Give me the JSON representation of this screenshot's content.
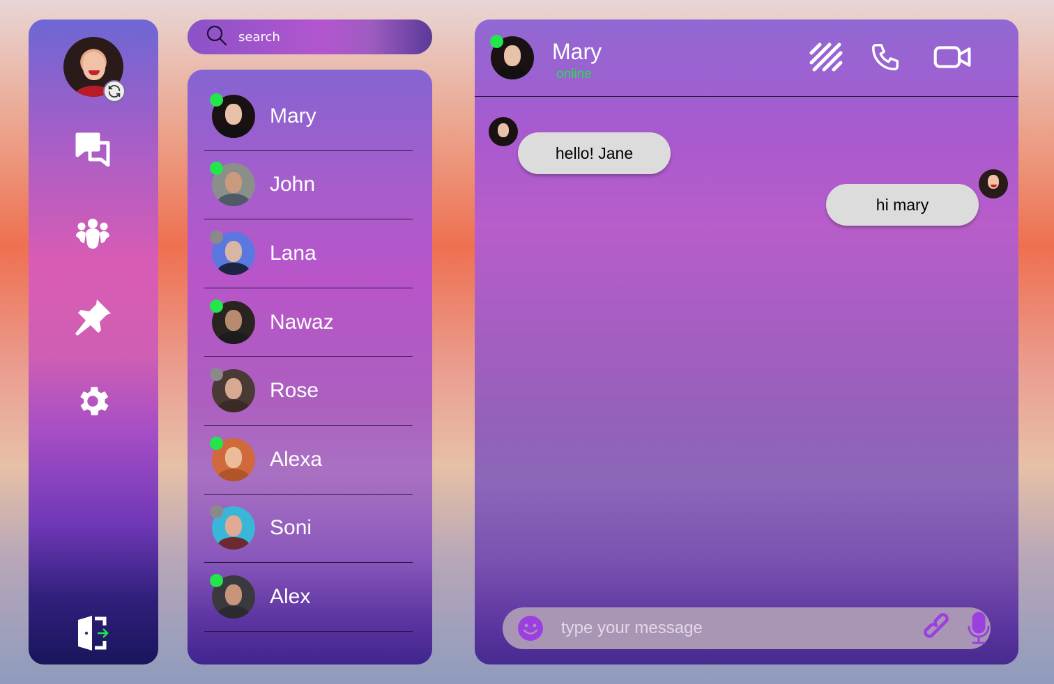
{
  "sidebar": {
    "profile_icon": "user-avatar",
    "sync_icon": "sync-icon",
    "nav": [
      {
        "id": "chats",
        "icon": "chat-bubbles-icon"
      },
      {
        "id": "groups",
        "icon": "group-icon"
      },
      {
        "id": "pinned",
        "icon": "pin-icon"
      },
      {
        "id": "settings",
        "icon": "gear-icon"
      }
    ],
    "logout_icon": "logout-icon"
  },
  "search": {
    "placeholder": "search"
  },
  "contacts": [
    {
      "name": "Mary",
      "online": true
    },
    {
      "name": "John",
      "online": true
    },
    {
      "name": "Lana",
      "online": false
    },
    {
      "name": "Nawaz",
      "online": true
    },
    {
      "name": "Rose",
      "online": false
    },
    {
      "name": "Alexa",
      "online": true
    },
    {
      "name": "Soni",
      "online": false
    },
    {
      "name": "Alex",
      "online": true
    }
  ],
  "chat": {
    "contact_name": "Mary",
    "contact_status": "online",
    "messages": [
      {
        "from": "them",
        "text": "hello! Jane"
      },
      {
        "from": "me",
        "text": "hi mary"
      }
    ],
    "composer_placeholder": "type your message"
  },
  "colors": {
    "online": "#22e64a",
    "offline": "#8a8a8a",
    "bubble": "#dcdcdc",
    "accent_purple": "#9b3fe0"
  }
}
